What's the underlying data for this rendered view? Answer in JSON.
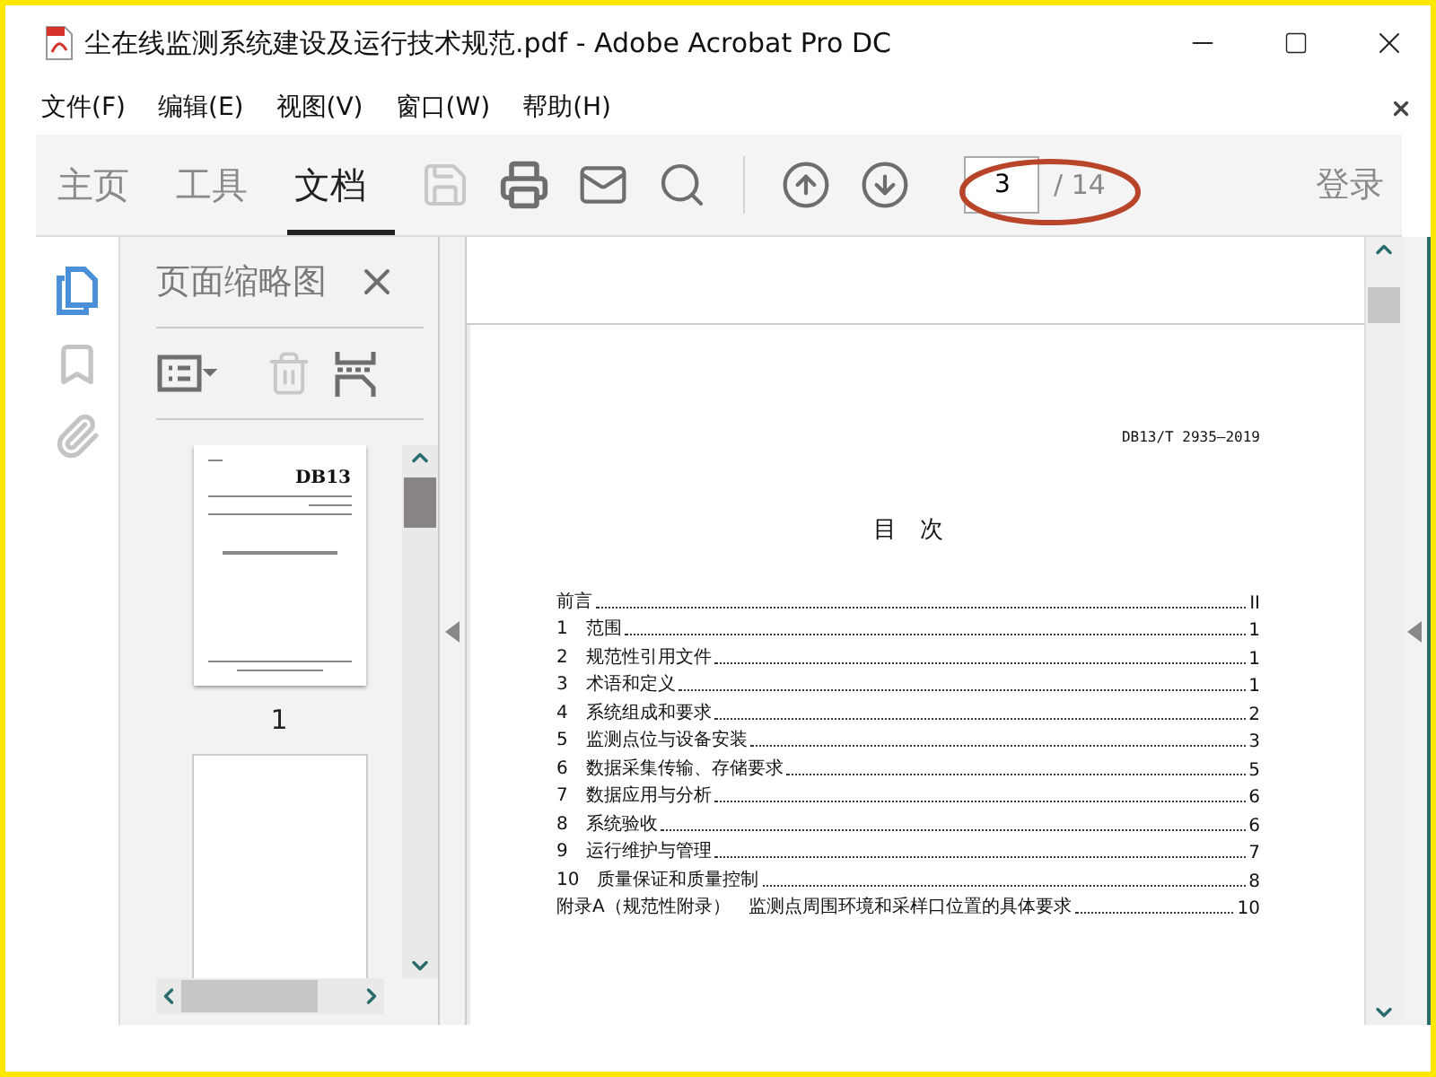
{
  "window": {
    "title": "尘在线监测系统建设及运行技术规范.pdf - Adobe Acrobat Pro DC"
  },
  "menu": [
    "文件(F)",
    "编辑(E)",
    "视图(V)",
    "窗口(W)",
    "帮助(H)"
  ],
  "toolbar": {
    "tabs": [
      {
        "label": "主页",
        "selected": false
      },
      {
        "label": "工具",
        "selected": false
      },
      {
        "label": "文档",
        "selected": true
      }
    ],
    "tools": [
      {
        "kind": "save",
        "disabled": true
      },
      {
        "kind": "print",
        "disabled": false
      },
      {
        "kind": "mail",
        "disabled": false
      },
      {
        "kind": "search",
        "disabled": false
      },
      {
        "kind": "prev",
        "disabled": false
      },
      {
        "kind": "next",
        "disabled": false
      }
    ],
    "page_field": {
      "value": "3"
    },
    "page_total": "/ 14",
    "sign_in": "登录"
  },
  "rail": [
    {
      "kind": "pages",
      "selected": true
    },
    {
      "kind": "bookmarks",
      "selected": false
    },
    {
      "kind": "attachments",
      "selected": false
    }
  ],
  "thumbnails_panel": {
    "title": "页面缩略图",
    "thumbnails": [
      {
        "cover": "DB13",
        "label": "1"
      }
    ]
  },
  "document": {
    "header": "DB13/T 2935—2019",
    "title": "目　次",
    "toc": [
      {
        "entry": "前言",
        "page": "II"
      },
      {
        "entry": "1　范围",
        "page": "1"
      },
      {
        "entry": "2　规范性引用文件",
        "page": "1"
      },
      {
        "entry": "3　术语和定义",
        "page": "1"
      },
      {
        "entry": "4　系统组成和要求",
        "page": "2"
      },
      {
        "entry": "5　监测点位与设备安装",
        "page": "3"
      },
      {
        "entry": "6　数据采集传输、存储要求",
        "page": "5"
      },
      {
        "entry": "7　数据应用与分析",
        "page": "6"
      },
      {
        "entry": "8　系统验收",
        "page": "6"
      },
      {
        "entry": "9　运行维护与管理",
        "page": "7"
      },
      {
        "entry": "10　质量保证和质量控制",
        "page": "8"
      },
      {
        "entry": "附录A（规范性附录）　监测点周围环境和采样口位置的具体要求",
        "page": "10"
      }
    ]
  }
}
